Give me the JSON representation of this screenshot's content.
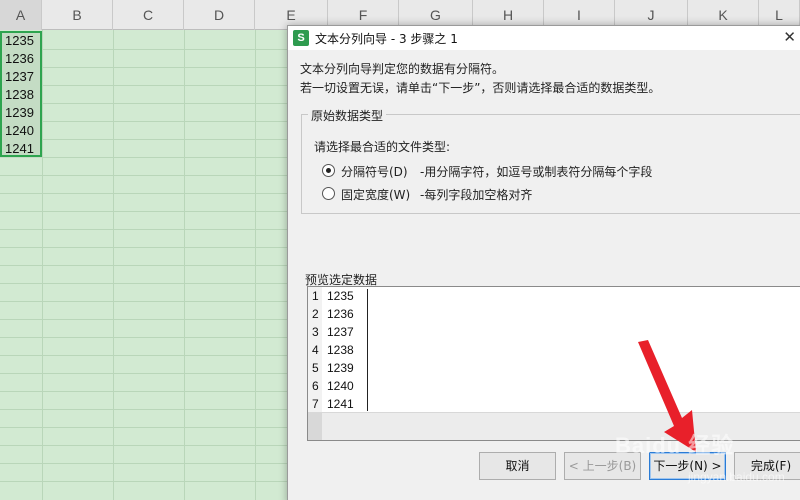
{
  "sheet": {
    "columns": [
      "A",
      "B",
      "C",
      "D",
      "E",
      "F",
      "G",
      "H",
      "I",
      "J",
      "K",
      "L"
    ],
    "cells": [
      "1235",
      "1236",
      "1237",
      "1238",
      "1239",
      "1240",
      "1241"
    ]
  },
  "dialog": {
    "icon_letter": "S",
    "title": "文本分列向导 - 3 步骤之 1",
    "intro1": "文本分列向导判定您的数据有分隔符。",
    "intro2": "若一切设置无误，请单击“下一步”，否则请选择最合适的数据类型。",
    "group_label": "原始数据类型",
    "prompt": "请选择最合适的文件类型:",
    "options": [
      {
        "label": "分隔符号(D)",
        "desc": "-用分隔字符，如逗号或制表符分隔每个字段",
        "checked": true
      },
      {
        "label": "固定宽度(W)",
        "desc": "-每列字段加空格对齐",
        "checked": false
      }
    ],
    "preview_label": "预览选定数据",
    "preview_rows": [
      {
        "num": "1",
        "val": "1235"
      },
      {
        "num": "2",
        "val": "1236"
      },
      {
        "num": "3",
        "val": "1237"
      },
      {
        "num": "4",
        "val": "1238"
      },
      {
        "num": "5",
        "val": "1239"
      },
      {
        "num": "6",
        "val": "1240"
      },
      {
        "num": "7",
        "val": "1241"
      }
    ],
    "buttons": {
      "cancel": "取消",
      "back": "< 上一步(B)",
      "next": "下一步(N) >",
      "finish": "完成(F)"
    }
  },
  "overlay": {
    "arrow_color": "#e8202a",
    "watermark": "Baidu 经验",
    "watermark_sub": "jingyan.baidu.com"
  }
}
